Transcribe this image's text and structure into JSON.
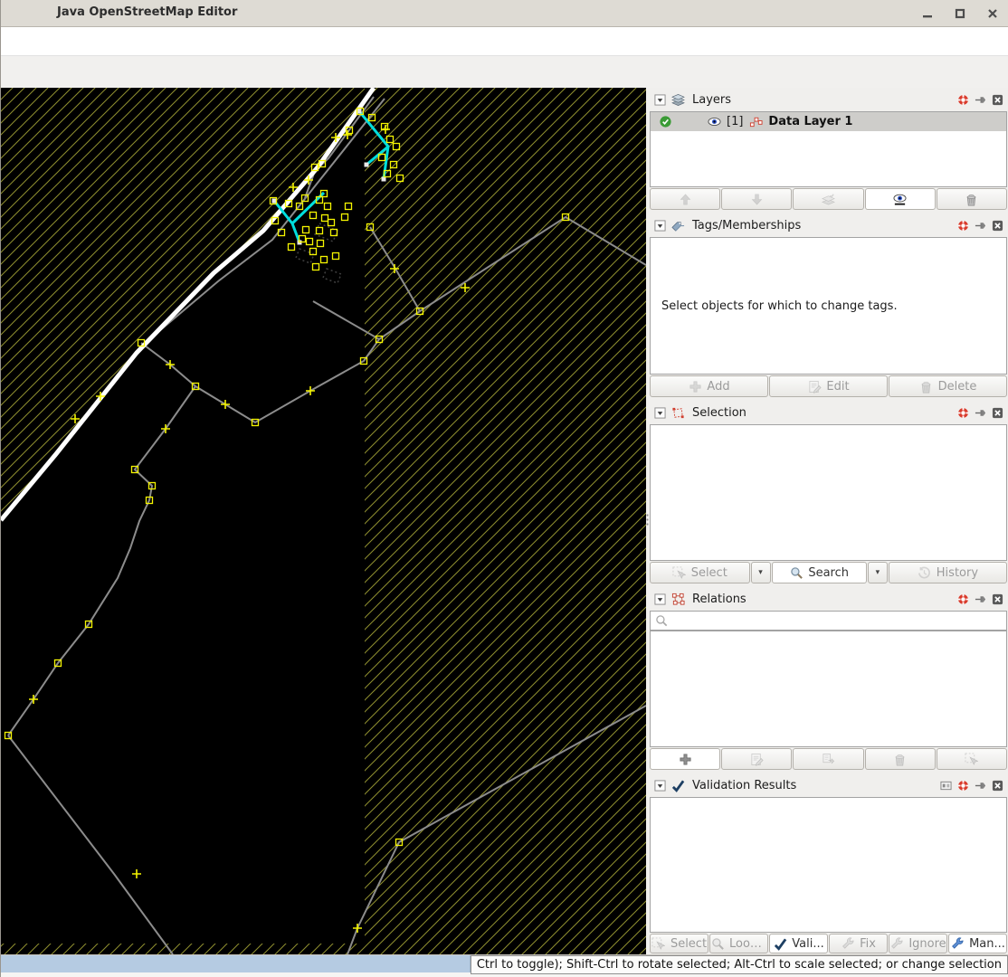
{
  "window": {
    "title": "Java OpenStreetMap Editor",
    "controls": {
      "minimize": "minimize",
      "maximize": "maximize",
      "close": "close"
    }
  },
  "panels": {
    "layers": {
      "title": "Layers",
      "row": {
        "index": "[1]",
        "label": "Data Layer 1",
        "active": true,
        "visible": true
      },
      "toolbar": [
        {
          "name": "move-layer-up",
          "enabled": false
        },
        {
          "name": "move-layer-down",
          "enabled": false
        },
        {
          "name": "merge-layer",
          "enabled": false
        },
        {
          "name": "toggle-visibility",
          "enabled": true,
          "active": true
        },
        {
          "name": "delete-layer",
          "enabled": true
        }
      ]
    },
    "tags": {
      "title": "Tags/Memberships",
      "message": "Select objects for which to change tags.",
      "buttons": {
        "add": {
          "label": "Add",
          "enabled": false
        },
        "edit": {
          "label": "Edit",
          "enabled": false
        },
        "delete": {
          "label": "Delete",
          "enabled": false
        }
      }
    },
    "selection": {
      "title": "Selection",
      "buttons": {
        "select": {
          "label": "Select",
          "enabled": false
        },
        "search": {
          "label": "Search",
          "enabled": true,
          "active": true
        },
        "history": {
          "label": "History",
          "enabled": false
        }
      }
    },
    "relations": {
      "title": "Relations",
      "search_value": "",
      "toolbar": [
        {
          "name": "new-relation",
          "enabled": true,
          "active": true
        },
        {
          "name": "edit-relation",
          "enabled": false
        },
        {
          "name": "duplicate-relation",
          "enabled": false
        },
        {
          "name": "delete-relation",
          "enabled": false
        },
        {
          "name": "select-relation-members",
          "enabled": false
        }
      ]
    },
    "validation": {
      "title": "Validation Results",
      "buttons": {
        "select": {
          "label": "Select",
          "enabled": false
        },
        "lookup": {
          "label": "Look...",
          "enabled": false
        },
        "validate": {
          "label": "Vali...",
          "enabled": true,
          "active": true
        },
        "fix": {
          "label": "Fix",
          "enabled": false
        },
        "ignore": {
          "label": "Ignore",
          "enabled": false
        },
        "manage": {
          "label": "Man...",
          "enabled": true,
          "active": true
        }
      }
    }
  },
  "statusbar": {
    "hint": "Ctrl to toggle); Shift-Ctrl to rotate selected; Alt-Ctrl to scale selected; or change selection"
  },
  "map": {
    "background_color": "#000000",
    "outside_download_hatch_color": "#8f8f2f",
    "way_color": "#8c8c8c",
    "road_color": "#ffffff",
    "node_color": "#f5f500",
    "selected_way_color": "#00dede",
    "active_layer": "Data Layer 1"
  }
}
